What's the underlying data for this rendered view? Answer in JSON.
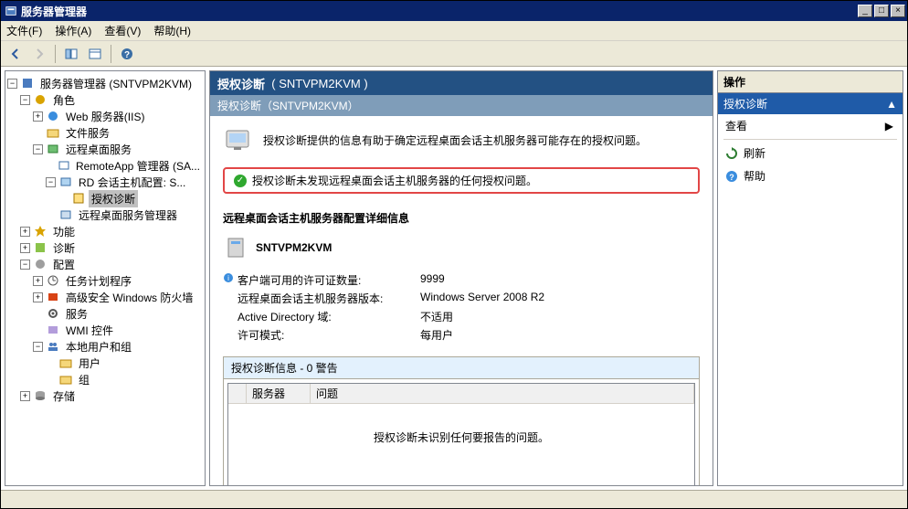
{
  "title": "服务器管理器",
  "menus": {
    "file": "文件(F)",
    "action": "操作(A)",
    "view": "查看(V)",
    "help": "帮助(H)"
  },
  "server_node_name": "SNTVPM2KVM",
  "tree": {
    "root": "服务器管理器 (",
    "roles": "角色",
    "web": "Web 服务器(IIS)",
    "file": "文件服务",
    "rds": "远程桌面服务",
    "remoteapp": "RemoteApp 管理器 (SA...",
    "rdcfg": "RD 会话主机配置: S...",
    "licdiag": "授权诊断",
    "rdsm": "远程桌面服务管理器",
    "features": "功能",
    "diag": "诊断",
    "config": "配置",
    "tasksched": "任务计划程序",
    "firewall": "高级安全 Windows 防火墙",
    "services": "服务",
    "wmi": "WMI 控件",
    "localusers": "本地用户和组",
    "users": "用户",
    "groups": "组",
    "storage": "存储"
  },
  "main": {
    "header": "授权诊断",
    "header_suffix": "(  SNTVPM2KVM  )",
    "subheader": "授权诊断（SNTVPM2KVM）",
    "intro": "授权诊断提供的信息有助于确定远程桌面会话主机服务器可能存在的授权问题。",
    "callout": "授权诊断未发现远程桌面会话主机服务器的任何授权问题。",
    "config_title": "远程桌面会话主机服务器配置详细信息",
    "server_name": "SNTVPM2KVM",
    "details": [
      {
        "label": "客户端可用的许可证数量:",
        "value": "9999"
      },
      {
        "label": "远程桌面会话主机服务器版本:",
        "value": "Windows Server 2008 R2"
      },
      {
        "label": "Active Directory 域:",
        "value": "不适用"
      },
      {
        "label": "许可模式:",
        "value": "每用户"
      }
    ],
    "diag_title": "授权诊断信息 - 0 警告",
    "diag_cols": {
      "server": "服务器",
      "issue": "问题"
    },
    "diag_empty": "授权诊断未识别任何要报告的问题。"
  },
  "actions": {
    "title": "操作",
    "section": "授权诊断",
    "view": "查看",
    "refresh": "刷新",
    "help": "帮助"
  }
}
